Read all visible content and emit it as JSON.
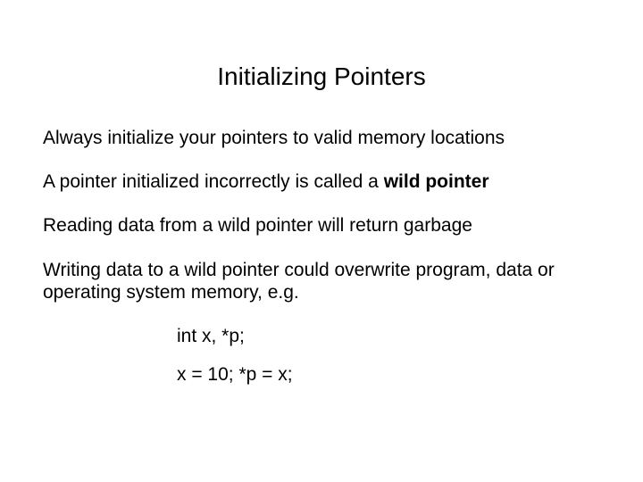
{
  "slide": {
    "title": "Initializing Pointers",
    "p1": "Always initialize your pointers to valid memory locations",
    "p2_pre": "A pointer initialized incorrectly is called a ",
    "p2_bold": "wild pointer",
    "p3": "Reading data from a wild pointer will return garbage",
    "p4": "Writing data to a wild pointer could overwrite program, data or operating system memory, e.g.",
    "code1": "int x, *p;",
    "code2": "x = 10;   *p = x;"
  }
}
